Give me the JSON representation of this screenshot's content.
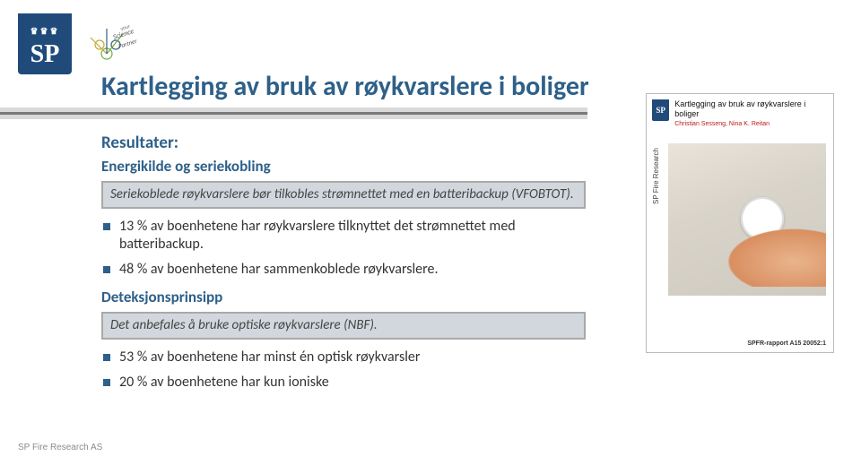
{
  "logo_text": "SP",
  "slide_title": "Kartlegging av bruk av røykvarslere i boliger",
  "results_heading": "Resultater:",
  "section1": {
    "subhead": "Energikilde og seriekobling",
    "note": "Seriekoblede røykvarslere bør tilkobles strømnettet med en batteribackup (VFOBTOT).",
    "bullets": [
      "13 % av boenhetene har røykvarslere tilknyttet det strømnettet med batteribackup.",
      "48 % av boenhetene har sammenkoblede røykvarslere."
    ]
  },
  "section2": {
    "subhead": "Deteksjonsprinsipp",
    "note": "Det anbefales å bruke optiske røykvarslere (NBF).",
    "bullets": [
      "53 % av boenhetene har minst én optisk røykvarsler",
      "20 % av boenhetene har kun ioniske"
    ]
  },
  "footer_brand": "SP Fire Research AS",
  "report_cover": {
    "mini_logo": "SP",
    "title": "Kartlegging av bruk av røykvarslere i boliger",
    "authors": "Christian Sesseng, Nina K. Reitan",
    "side_label": "SP Fire Research",
    "code": "SPFR-rapport A15 20052:1"
  }
}
